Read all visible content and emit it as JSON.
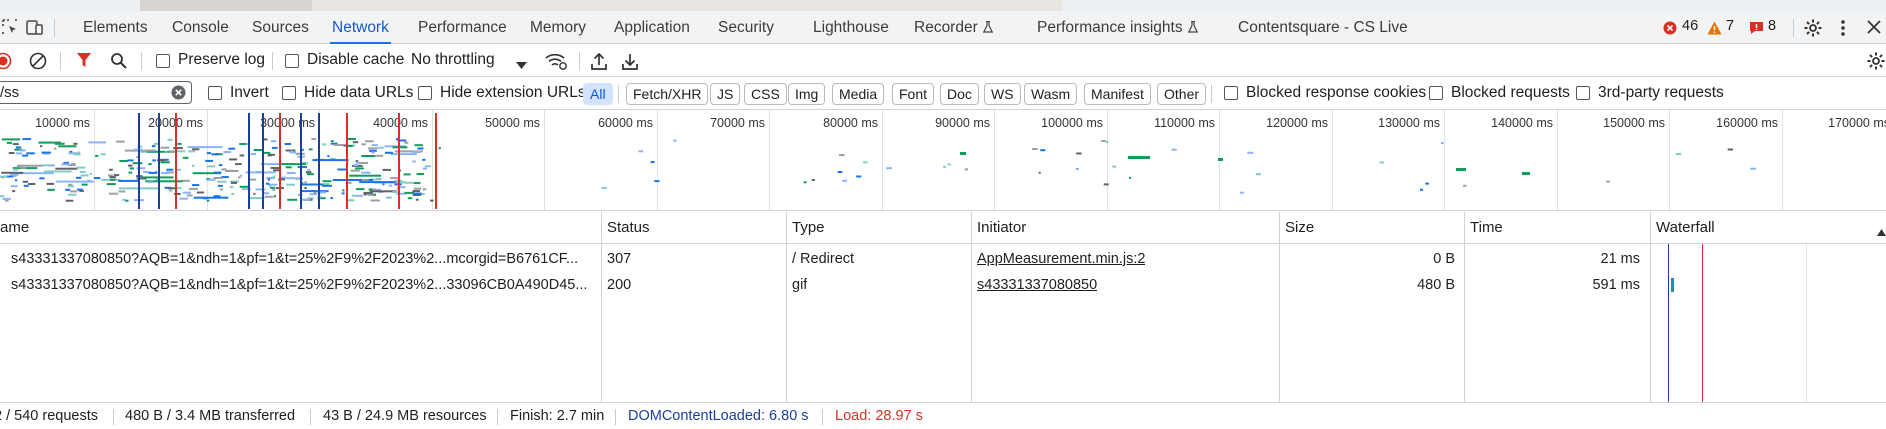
{
  "tabs": [
    {
      "label": "Elements"
    },
    {
      "label": "Console"
    },
    {
      "label": "Sources"
    },
    {
      "label": "Network"
    },
    {
      "label": "Performance"
    },
    {
      "label": "Memory"
    },
    {
      "label": "Application"
    },
    {
      "label": "Security"
    },
    {
      "label": "Lighthouse"
    },
    {
      "label": "Recorder"
    },
    {
      "label": "Performance insights"
    },
    {
      "label": "Contentsquare - CS Live"
    }
  ],
  "counts": {
    "errors": "46",
    "warnings": "7",
    "issues": "8"
  },
  "toolbar": {
    "preserve_log": "Preserve log",
    "disable_cache": "Disable cache",
    "throttling": "No throttling"
  },
  "filter": {
    "value": "/ss",
    "invert": "Invert",
    "hide_data_urls": "Hide data URLs",
    "hide_extension_urls": "Hide extension URLs",
    "types": [
      "All",
      "Fetch/XHR",
      "JS",
      "CSS",
      "Img",
      "Media",
      "Font",
      "Doc",
      "WS",
      "Wasm",
      "Manifest",
      "Other"
    ],
    "blocked_response_cookies": "Blocked response cookies",
    "blocked_requests": "Blocked requests",
    "third_party": "3rd-party requests"
  },
  "overview_ticks": [
    "10000 ms",
    "20000 ms",
    "30000 ms",
    "40000 ms",
    "50000 ms",
    "60000 ms",
    "70000 ms",
    "80000 ms",
    "90000 ms",
    "100000 ms",
    "110000 ms",
    "120000 ms",
    "130000 ms",
    "140000 ms",
    "150000 ms",
    "160000 ms",
    "170000 ms"
  ],
  "columns": {
    "name": "ame",
    "status": "Status",
    "type": "Type",
    "initiator": "Initiator",
    "size": "Size",
    "time": "Time",
    "waterfall": "Waterfall"
  },
  "rows": [
    {
      "name": "s43331337080850?AQB=1&ndh=1&pf=1&t=25%2F9%2F2023%2...mcorgid=B6761CF...",
      "status": "307",
      "type": "/ Redirect",
      "initiator": "AppMeasurement.min.js:2",
      "size": "0 B",
      "time": "21 ms"
    },
    {
      "name": "s43331337080850?AQB=1&ndh=1&pf=1&t=25%2F9%2F2023%2...33096CB0A490D45...",
      "status": "200",
      "type": "gif",
      "initiator": "s43331337080850",
      "size": "480 B",
      "time": "591 ms"
    }
  ],
  "status": {
    "requests": "2 / 540 requests",
    "transferred": "480 B / 3.4 MB transferred",
    "resources": "43 B / 24.9 MB resources",
    "finish": "Finish: 2.7 min",
    "dcl": "DOMContentLoaded: 6.80 s",
    "load": "Load: 28.97 s"
  },
  "colors": {
    "accent": "#1a73e8",
    "dcl": "#1a3f9c",
    "load": "#d93025",
    "error": "#d93025",
    "warning": "#e37400"
  }
}
